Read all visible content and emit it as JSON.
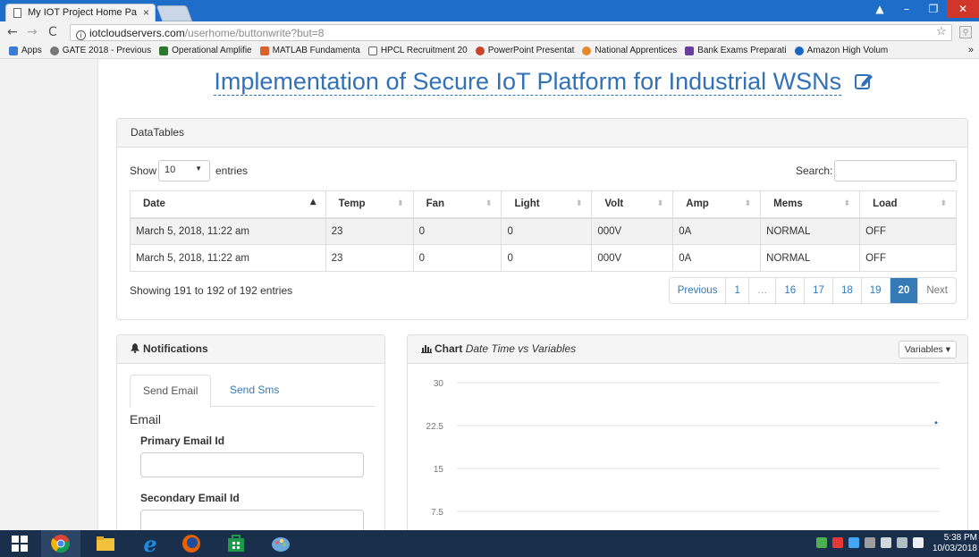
{
  "browser": {
    "tab_title": "My IOT Project Home Pa",
    "url_host": "iotcloudservers.com",
    "url_path": "/userhome/buttonwrite?but=8",
    "bookmarks": [
      "Apps",
      "GATE 2018 - Previous",
      "Operational Amplifie",
      "MATLAB Fundamenta",
      "HPCL Recruitment 20",
      "PowerPoint Presentat",
      "National Apprentices",
      "Bank Exams Preparati",
      "Amazon High Volum"
    ],
    "bookmarks_more": "»"
  },
  "page": {
    "title": "Implementation of Secure IoT Platform for Industrial WSNs"
  },
  "datatable": {
    "panel_title": "DataTables",
    "show_label": "Show",
    "page_length": "10",
    "entries_label": "entries",
    "search_label": "Search:",
    "columns": [
      "Date",
      "Temp",
      "Fan",
      "Light",
      "Volt",
      "Amp",
      "Mems",
      "Load"
    ],
    "rows": [
      [
        "March 5, 2018, 11:22 am",
        "23",
        "0",
        "0",
        "000V",
        "0A",
        "NORMAL",
        "OFF"
      ],
      [
        "March 5, 2018, 11:22 am",
        "23",
        "0",
        "0",
        "000V",
        "0A",
        "NORMAL",
        "OFF"
      ]
    ],
    "info": "Showing 191 to 192 of 192 entries",
    "pagination": [
      "Previous",
      "1",
      "…",
      "16",
      "17",
      "18",
      "19",
      "20",
      "Next"
    ],
    "active_page": "20"
  },
  "notifications": {
    "title": "Notifications",
    "tabs": [
      "Send Email",
      "Send Sms"
    ],
    "section": "Email",
    "primary_label": "Primary Email Id",
    "secondary_label": "Secondary Email Id"
  },
  "chart": {
    "heading_bold": "Chart",
    "heading_italic": "Date Time vs Variables",
    "variables_button": "Variables ▾"
  },
  "chart_data": {
    "type": "line",
    "y_ticks": [
      "30",
      "22.5",
      "15",
      "7.5"
    ],
    "ylim": [
      7.5,
      30
    ],
    "series": [
      {
        "values": [
          23
        ]
      }
    ]
  },
  "taskbar": {
    "time": "5:38 PM",
    "date": "10/03/2018"
  },
  "colors": {
    "accent": "#337ab7",
    "title_blue": "#3071b8",
    "chart_point": "#3b6bc4"
  }
}
